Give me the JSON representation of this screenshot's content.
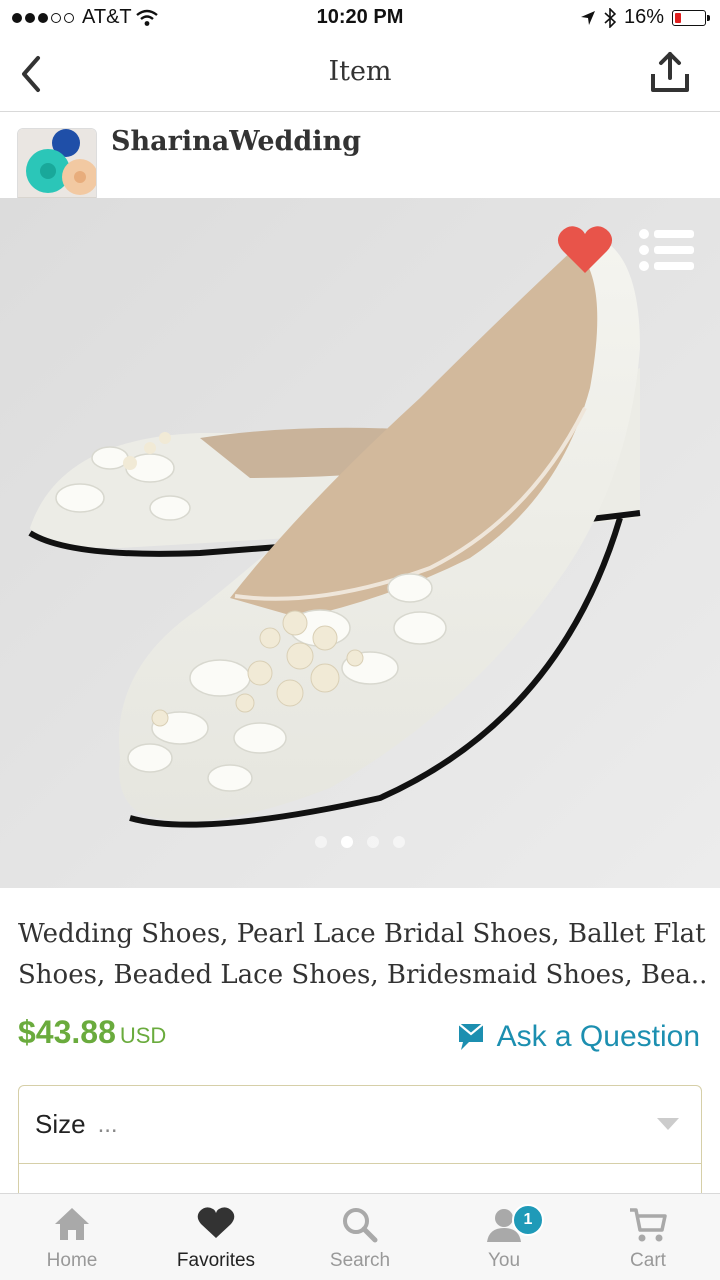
{
  "status": {
    "carrier": "AT&T",
    "time": "10:20 PM",
    "battery": "16%"
  },
  "nav": {
    "title": "Item"
  },
  "shop": {
    "name": "SharinaWedding"
  },
  "listing": {
    "title_line1": "Wedding Shoes, Pearl Lace Bridal Shoes, Ballet Flat",
    "title_line2": "Shoes, Beaded Lace Shoes, Bridesmaid Shoes, Bea...",
    "price": "$43.88",
    "currency": "USD",
    "ask_label": "Ask a Question",
    "image_count": 4,
    "current_image": 2
  },
  "options": [
    {
      "label": "Size",
      "value": "..."
    }
  ],
  "tabs": [
    {
      "label": "Home",
      "icon": "home-icon"
    },
    {
      "label": "Favorites",
      "icon": "heart-icon",
      "active": true
    },
    {
      "label": "Search",
      "icon": "search-icon"
    },
    {
      "label": "You",
      "icon": "user-icon",
      "badge": "1"
    },
    {
      "label": "Cart",
      "icon": "cart-icon"
    }
  ],
  "colors": {
    "price": "#6aab3d",
    "link": "#1c8fb0",
    "heart": "#e8544a",
    "battery_low": "#e02020"
  }
}
